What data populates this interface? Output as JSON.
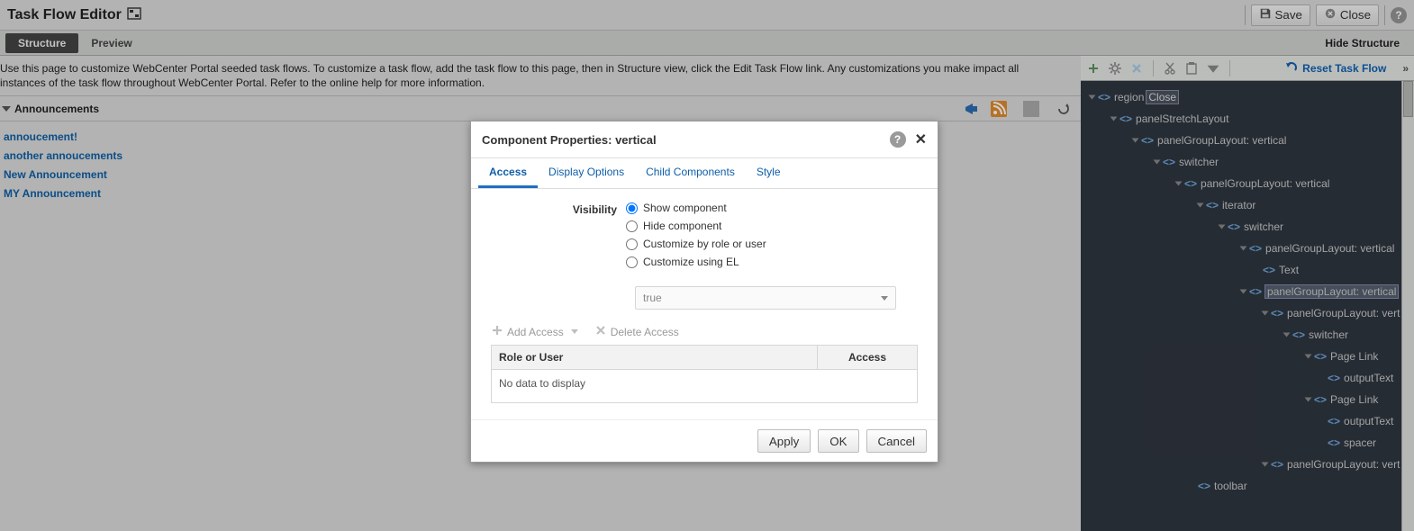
{
  "header": {
    "title": "Task Flow Editor",
    "save": "Save",
    "close": "Close"
  },
  "tabs": {
    "structure": "Structure",
    "preview": "Preview",
    "hide": "Hide Structure"
  },
  "info": {
    "line1": "Use this page to customize WebCenter Portal seeded task flows. To customize a task flow, add the task flow to this page, then in Structure view, click the Edit Task Flow link. Any customizations you make impact all",
    "line2": "instances of the task flow throughout WebCenter Portal. Refer to the online help for more information."
  },
  "section": {
    "title": "Announcements"
  },
  "announcements": [
    "annoucement!",
    "another annoucements",
    "New Announcement",
    "MY Announcement"
  ],
  "structure": {
    "reset": "Reset Task Flow",
    "nodes": {
      "region": "region",
      "regionBadge": "Close",
      "panelStretch": "panelStretchLayout",
      "pgl_vertical": "panelGroupLayout: vertical",
      "switcher": "switcher",
      "iterator": "iterator",
      "text": "Text",
      "pagelink": "Page Link",
      "outputText": "outputText",
      "spacer": "spacer",
      "pgl_vert_trunc": "panelGroupLayout: vert",
      "toolbar": "toolbar"
    }
  },
  "dialog": {
    "title": "Component Properties: vertical",
    "tabs": {
      "access": "Access",
      "display": "Display Options",
      "child": "Child Components",
      "style": "Style"
    },
    "visibility_label": "Visibility",
    "options": {
      "show": "Show component",
      "hide": "Hide component",
      "custom_role": "Customize by role or user",
      "custom_el": "Customize using EL"
    },
    "el_value": "true",
    "add_access": "Add Access",
    "delete_access": "Delete Access",
    "table": {
      "col_role": "Role or User",
      "col_access": "Access",
      "empty": "No data to display"
    },
    "buttons": {
      "apply": "Apply",
      "ok": "OK",
      "cancel": "Cancel"
    }
  }
}
